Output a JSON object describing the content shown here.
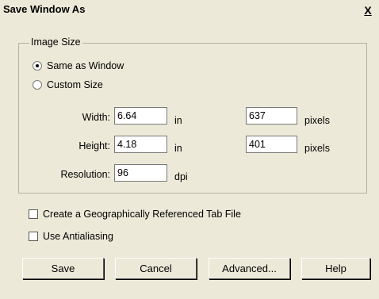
{
  "window": {
    "title": "Save Window As",
    "close_label": "X"
  },
  "image_size": {
    "group_label": "Image Size",
    "same_as_window_label": "Same as Window",
    "custom_size_label": "Custom Size",
    "selected": "same_as_window",
    "width_label": "Width:",
    "width_value": "6.64",
    "width_unit": "in",
    "width_pixels": "637",
    "pixels_unit": "pixels",
    "height_label": "Height:",
    "height_value": "4.18",
    "height_unit": "in",
    "height_pixels": "401",
    "resolution_label": "Resolution:",
    "resolution_value": "96",
    "resolution_unit": "dpi"
  },
  "options": {
    "geo_tab_label": "Create a Geographically Referenced Tab File",
    "geo_tab_checked": false,
    "antialias_label": "Use Antialiasing",
    "antialias_checked": false
  },
  "buttons": {
    "save": "Save",
    "cancel": "Cancel",
    "advanced": "Advanced...",
    "help": "Help"
  }
}
